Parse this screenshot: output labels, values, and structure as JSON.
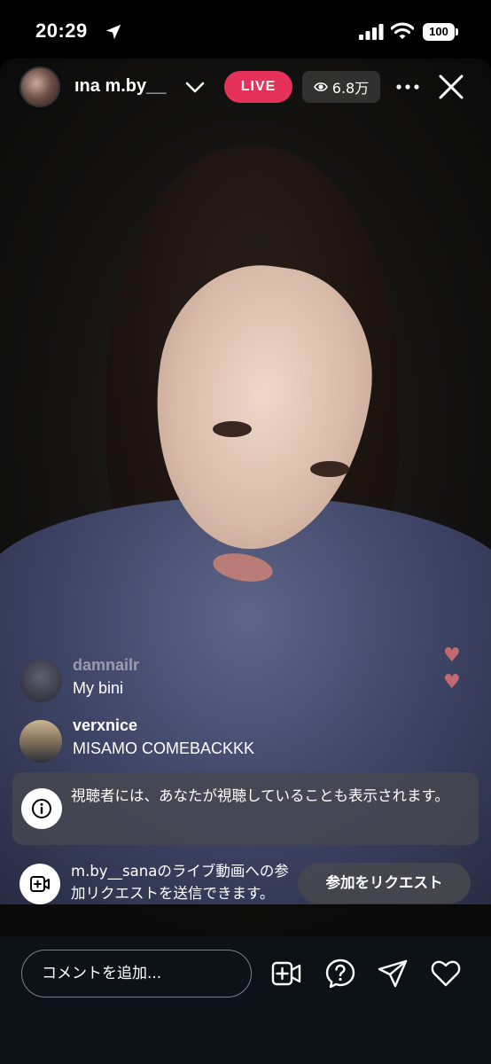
{
  "status_bar": {
    "time": "20:29",
    "battery": "100",
    "location_icon": "location-arrow-icon",
    "signal_icon": "cellular-signal-icon",
    "wifi_icon": "wifi-icon"
  },
  "header": {
    "username": "ına   m.by__",
    "live_label": "LIVE",
    "viewer_count": "6.8万",
    "live_color": "#e5325a"
  },
  "comments": [
    {
      "username": "damnailr",
      "text": "My bini"
    },
    {
      "username": "verxnice",
      "text": "MISAMO COMEBACKKK"
    }
  ],
  "notice": {
    "text": "視聴者には、あなたが視聴していることも表示されます。"
  },
  "join": {
    "text": "m.by__sanaのライブ動画への参加リクエストを送信できます。",
    "button_label": "参加をリクエスト"
  },
  "bottom_bar": {
    "comment_placeholder": "コメントを追加..."
  }
}
